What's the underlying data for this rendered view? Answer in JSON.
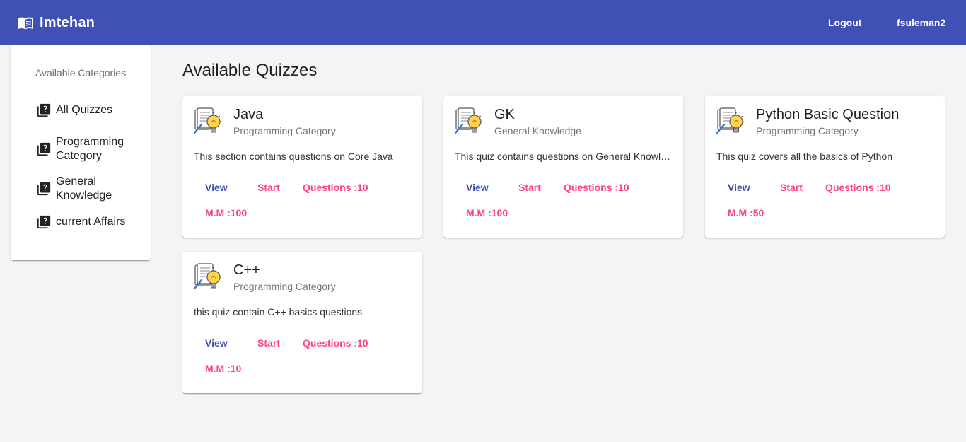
{
  "app": {
    "title": "Imtehan",
    "accent_color": "#3f51b5",
    "secondary_color": "#ff4081",
    "brand_icon": "menu-book-icon"
  },
  "toolbar": {
    "logout_label": "Logout",
    "username": "fsuleman2"
  },
  "sidebar": {
    "heading": "Available Categories",
    "item_icon": "live-help-icon",
    "items": [
      {
        "label": "All Quizzes"
      },
      {
        "label": "Programming Category"
      },
      {
        "label": "General Knowledge"
      },
      {
        "label": "current Affairs"
      }
    ]
  },
  "main": {
    "title": "Available Quizzes",
    "quiz_icon": "idea-document-icon",
    "quizzes": [
      {
        "title": "Java",
        "category": "Programming Category",
        "description": "This section contains questions on Core Java",
        "view_label": "View",
        "start_label": "Start",
        "questions_label": "Questions :10",
        "marks_label": "M.M :100"
      },
      {
        "title": "GK",
        "category": "General Knowledge",
        "description": "This quiz contains questions on General Knowledge",
        "view_label": "View",
        "start_label": "Start",
        "questions_label": "Questions :10",
        "marks_label": "M.M :100"
      },
      {
        "title": "Python Basic Question",
        "category": "Programming Category",
        "description": "This quiz covers all the basics of Python",
        "view_label": "View",
        "start_label": "Start",
        "questions_label": "Questions :10",
        "marks_label": "M.M :50"
      },
      {
        "title": "C++",
        "category": "Programming Category",
        "description": "this quiz contain C++ basics questions",
        "view_label": "View",
        "start_label": "Start",
        "questions_label": "Questions :10",
        "marks_label": "M.M :10"
      }
    ]
  }
}
